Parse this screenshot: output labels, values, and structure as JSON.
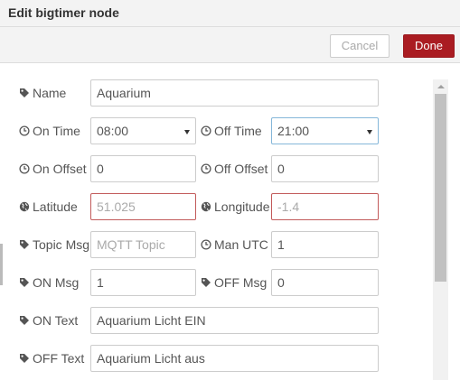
{
  "dialog": {
    "title": "Edit bigtimer node"
  },
  "toolbar": {
    "cancel_label": "Cancel",
    "done_label": "Done"
  },
  "form": {
    "name": {
      "label": "Name",
      "value": "Aquarium"
    },
    "on_time": {
      "label": "On Time",
      "value": "08:00"
    },
    "off_time": {
      "label": "Off Time",
      "value": "21:00"
    },
    "on_offset": {
      "label": "On Offset",
      "value": "0"
    },
    "off_offset": {
      "label": "Off Offset",
      "value": "0"
    },
    "latitude": {
      "label": "Latitude",
      "placeholder": "51.025"
    },
    "longitude": {
      "label": "Longitude",
      "placeholder": "-1.4"
    },
    "topic_msg": {
      "label": "Topic Msg",
      "placeholder": "MQTT Topic"
    },
    "man_utc": {
      "label": "Man UTC",
      "value": "1"
    },
    "on_msg": {
      "label": "ON Msg",
      "value": "1"
    },
    "off_msg": {
      "label": "OFF Msg",
      "value": "0"
    },
    "on_text": {
      "label": "ON Text",
      "value": "Aquarium Licht EIN"
    },
    "off_text": {
      "label": "OFF Text",
      "value": "Aquarium Licht aus"
    }
  },
  "colors": {
    "accent": "#aa1c22",
    "invalid_border": "#c25a5a",
    "focus_border": "#85b7d9",
    "label": "#555555"
  },
  "icons": [
    "tag-icon",
    "clock-icon",
    "globe-icon",
    "chevron-down-icon",
    "scroll-up-arrow-icon"
  ]
}
